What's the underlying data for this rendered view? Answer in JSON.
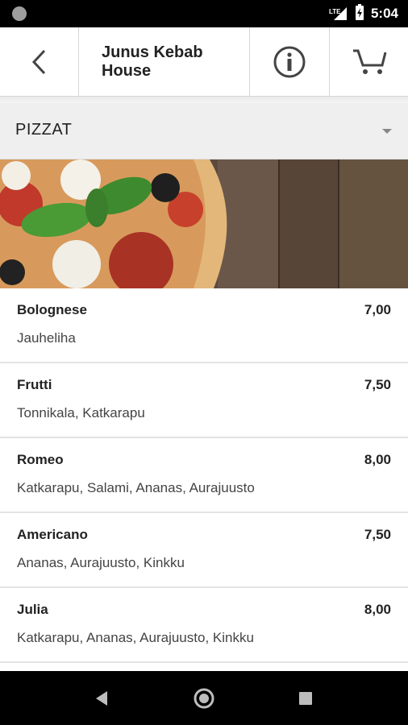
{
  "status_bar": {
    "network_label": "LTE",
    "time": "5:04"
  },
  "header": {
    "title": "Junus Kebab House",
    "icons": {
      "back": "back-arrow-icon",
      "info": "info-icon",
      "cart": "cart-icon"
    }
  },
  "category": {
    "label": "PIZZAT"
  },
  "menu": {
    "items": [
      {
        "name": "Bolognese",
        "price": "7,00",
        "description": "Jauheliha"
      },
      {
        "name": "Frutti",
        "price": "7,50",
        "description": "Tonnikala, Katkarapu"
      },
      {
        "name": "Romeo",
        "price": "8,00",
        "description": "Katkarapu, Salami, Ananas, Aurajuusto"
      },
      {
        "name": "Americano",
        "price": "7,50",
        "description": "Ananas, Aurajuusto, Kinkku"
      },
      {
        "name": "Julia",
        "price": "8,00",
        "description": "Katkarapu, Ananas, Aurajuusto, Kinkku"
      }
    ]
  },
  "colors": {
    "header_bg": "#ffffff",
    "category_bg": "#efefef",
    "text": "#222222"
  }
}
